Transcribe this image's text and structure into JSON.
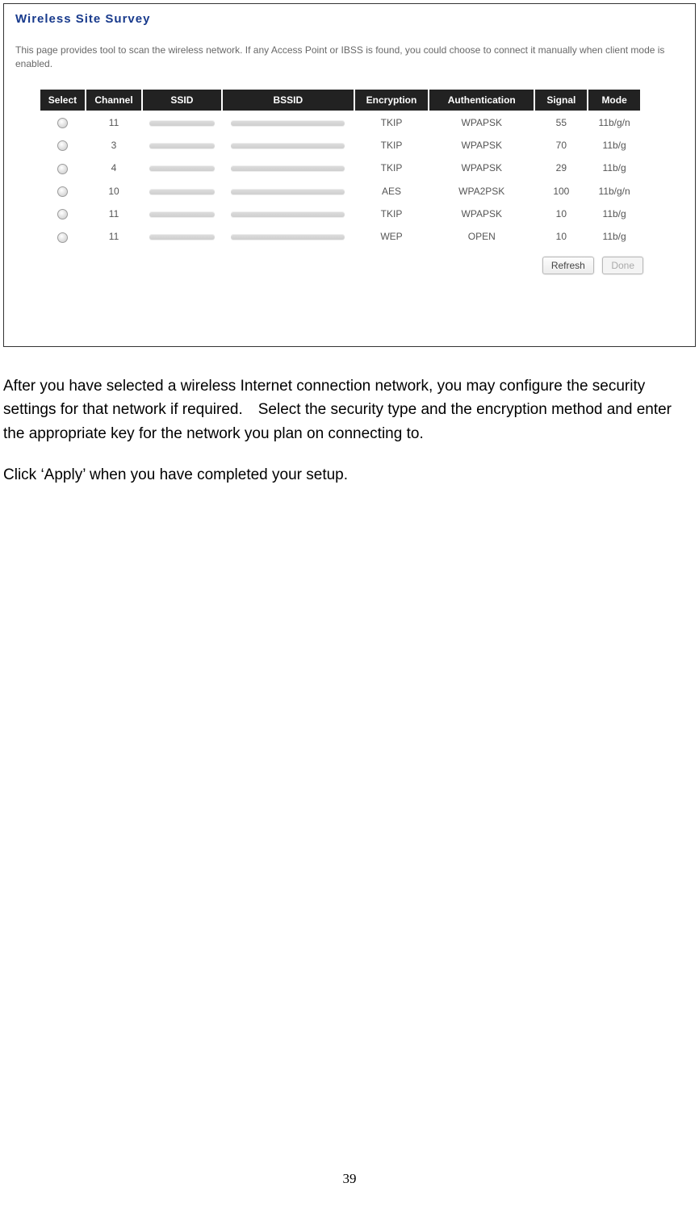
{
  "panel": {
    "title": "Wireless Site Survey",
    "description": "This page provides tool to scan the wireless network. If any Access Point or IBSS is found, you could choose to connect it manually when client mode is enabled.",
    "headers": {
      "select": "Select",
      "channel": "Channel",
      "ssid": "SSID",
      "bssid": "BSSID",
      "encryption": "Encryption",
      "authentication": "Authentication",
      "signal": "Signal",
      "mode": "Mode"
    },
    "rows": [
      {
        "channel": "11",
        "encryption": "TKIP",
        "auth": "WPAPSK",
        "signal": "55",
        "mode": "11b/g/n"
      },
      {
        "channel": "3",
        "encryption": "TKIP",
        "auth": "WPAPSK",
        "signal": "70",
        "mode": "11b/g"
      },
      {
        "channel": "4",
        "encryption": "TKIP",
        "auth": "WPAPSK",
        "signal": "29",
        "mode": "11b/g"
      },
      {
        "channel": "10",
        "encryption": "AES",
        "auth": "WPA2PSK",
        "signal": "100",
        "mode": "11b/g/n"
      },
      {
        "channel": "11",
        "encryption": "TKIP",
        "auth": "WPAPSK",
        "signal": "10",
        "mode": "11b/g"
      },
      {
        "channel": "11",
        "encryption": "WEP",
        "auth": "OPEN",
        "signal": "10",
        "mode": "11b/g"
      }
    ],
    "buttons": {
      "refresh": "Refresh",
      "done": "Done"
    }
  },
  "body": {
    "p1": "After you have selected a wireless Internet connection network, you may configure the security settings for that network if required. Select the security type and the encryption method and enter the appropriate key for the network you plan on connecting to.",
    "p2": "Click ‘Apply’ when you have completed your setup."
  },
  "page_number": "39"
}
